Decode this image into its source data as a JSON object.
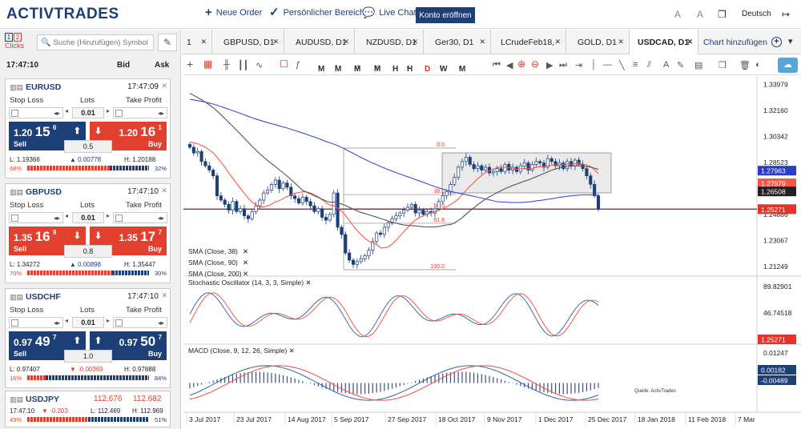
{
  "header": {
    "logo_main": "ACTIV",
    "logo_accent": "TRADES",
    "new_order": "Neue Order",
    "personal_area": "Persönlicher Bereich",
    "live_chat": "Live Chat",
    "open_account": "Konto eröffnen",
    "language": "Deutsch"
  },
  "left_panel": {
    "clicks_label": "Clicks",
    "click_options": [
      "1",
      "2"
    ],
    "search_placeholder": "Suche (Hinzufügen) Symbol",
    "clock": "17:47:10",
    "bid_label": "Bid",
    "ask_label": "Ask",
    "field_labels": {
      "stop_loss": "Stop Loss",
      "lots": "Lots",
      "take_profit": "Take Profit",
      "sell": "Sell",
      "buy": "Buy"
    },
    "instruments": [
      {
        "symbol": "EURUSD",
        "time": "17:47:09",
        "lots": "0.01",
        "sell_prefix": "1.20",
        "sell_big": "15",
        "sell_sup": "6",
        "buy_prefix": "1.20",
        "buy_big": "16",
        "buy_sup": "1",
        "sell_color": "#1d3f78",
        "buy_color": "#e2402e",
        "sell_dir": "up",
        "buy_dir": "down",
        "spread": "0.5",
        "low": "L: 1.19366",
        "change": "▲ 0.00778",
        "high": "H: 1.20188",
        "sell_pct": "68%",
        "buy_pct": "32%",
        "sell_share": 0.68
      },
      {
        "symbol": "GBPUSD",
        "time": "17:47:10",
        "lots": "0.01",
        "sell_prefix": "1.35",
        "sell_big": "16",
        "sell_sup": "9",
        "buy_prefix": "1.35",
        "buy_big": "17",
        "buy_sup": "7",
        "sell_color": "#e2402e",
        "buy_color": "#e2402e",
        "sell_dir": "down",
        "buy_dir": "down",
        "spread": "0.8",
        "low": "L: 1.34272",
        "change": "▲ 0.00898",
        "high": "H: 1.35447",
        "sell_pct": "70%",
        "buy_pct": "30%",
        "sell_share": 0.7
      },
      {
        "symbol": "USDCHF",
        "time": "17:47:10",
        "lots": "0.01",
        "sell_prefix": "0.97",
        "sell_big": "49",
        "sell_sup": "7",
        "buy_prefix": "0.97",
        "buy_big": "50",
        "buy_sup": "7",
        "sell_color": "#1d3f78",
        "buy_color": "#1d3f78",
        "sell_dir": "up",
        "buy_dir": "up",
        "spread": "1.0",
        "low": "L: 0.97407",
        "change": "▼ -0.00369",
        "high": "H: 0.97888",
        "sell_pct": "16%",
        "buy_pct": "84%",
        "sell_share": 0.16
      }
    ],
    "usdjpy": {
      "symbol": "USDJPY",
      "bid": "112.676",
      "ask": "112.682",
      "time": "17:47:10",
      "change": "▼ -0.203",
      "low": "L: 112.469",
      "high": "H: 112.969",
      "sell_pct": "49%",
      "buy_pct": "51%",
      "sell_share": 0.49
    }
  },
  "tabs": [
    {
      "label": "1",
      "active": false
    },
    {
      "label": "GBPUSD, D1",
      "active": false
    },
    {
      "label": "AUDUSD, D1",
      "active": false
    },
    {
      "label": "NZDUSD, D1",
      "active": false
    },
    {
      "label": "Ger30, D1",
      "active": false
    },
    {
      "label": "LCrudeFeb18,",
      "active": false
    },
    {
      "label": "GOLD, D1",
      "active": false
    },
    {
      "label": "USDCAD, D1",
      "active": true
    },
    {
      "label": "Chart hinzufügen",
      "active": false
    }
  ],
  "timeframes": [
    {
      "base": "M",
      "sub": "1",
      "sel": false
    },
    {
      "base": "M",
      "sub": "5",
      "sel": false
    },
    {
      "base": "M",
      "sub": "15",
      "sel": false
    },
    {
      "base": "M",
      "sub": "30",
      "sel": false
    },
    {
      "base": "H",
      "sub": "1",
      "sel": false
    },
    {
      "base": "H",
      "sub": "4",
      "sel": false
    },
    {
      "base": "D",
      "sub": "1",
      "sel": true
    },
    {
      "base": "W",
      "sub": "1",
      "sel": false
    },
    {
      "base": "M",
      "sub": "n",
      "sel": false
    }
  ],
  "chart_data": {
    "type": "candlestick",
    "symbol": "USDCAD",
    "timeframe": "D1",
    "price_axis": [
      "1.33979",
      "1.32160",
      "1.30342",
      "1.28523",
      "1.26704",
      "1.24886",
      "1.23067",
      "1.21249"
    ],
    "price_ylim": [
      1.2075,
      1.3458
    ],
    "price_tags": [
      {
        "label": "1.27963",
        "value": 1.27963,
        "color": "#2a3ec8"
      },
      {
        "label": "1.27079",
        "value": 1.27079,
        "color": "#f05a4a"
      },
      {
        "label": "1.26508",
        "value": 1.26508,
        "color": "#222222"
      },
      {
        "label": "1.25271",
        "value": 1.25271,
        "color": "#e4332a"
      }
    ],
    "x_axis": [
      "3 Jul 2017",
      "23 Jul 2017",
      "14 Aug 2017",
      "5 Sep 2017",
      "27 Sep 2017",
      "18 Oct 2017",
      "9 Nov 2017",
      "1 Dec 2017",
      "25 Dec 2017",
      "18 Jan 2018",
      "11 Feb 2018",
      "7 Mar"
    ],
    "candles_close": [
      1.296,
      1.292,
      1.293,
      1.286,
      1.283,
      1.28,
      1.276,
      1.262,
      1.259,
      1.256,
      1.252,
      1.258,
      1.251,
      1.253,
      1.248,
      1.246,
      1.251,
      1.255,
      1.259,
      1.264,
      1.266,
      1.27,
      1.273,
      1.267,
      1.271,
      1.268,
      1.262,
      1.26,
      1.257,
      1.261,
      1.258,
      1.255,
      1.251,
      1.253,
      1.247,
      1.245,
      1.249,
      1.264,
      1.24,
      1.235,
      1.222,
      1.217,
      1.214,
      1.216,
      1.218,
      1.22,
      1.224,
      1.23,
      1.236,
      1.235,
      1.24,
      1.243,
      1.246,
      1.248,
      1.25,
      1.252,
      1.254,
      1.256,
      1.25,
      1.252,
      1.249,
      1.251,
      1.25,
      1.253,
      1.258,
      1.262,
      1.265,
      1.27,
      1.275,
      1.282,
      1.286,
      1.289,
      1.284,
      1.281,
      1.283,
      1.28,
      1.282,
      1.278,
      1.279,
      1.281,
      1.279,
      1.284,
      1.28,
      1.282,
      1.279,
      1.283,
      1.285,
      1.28,
      1.284,
      1.286,
      1.285,
      1.282,
      1.288,
      1.286,
      1.283,
      1.285,
      1.281,
      1.286,
      1.283,
      1.287,
      1.284,
      1.281,
      1.276,
      1.27,
      1.262,
      1.253
    ],
    "sma_series": [
      {
        "name": "SMA (Close, 38)",
        "color": "#f05a4a"
      },
      {
        "name": "SMA (Close, 90)",
        "color": "#555555"
      },
      {
        "name": "SMA (Close, 200)",
        "color": "#3a4fd0"
      }
    ],
    "fib_levels": [
      "0.0",
      "38.2",
      "50.0",
      "61.8",
      "100.0"
    ],
    "stochastic": {
      "title": "Stochastic Oscillator (14, 3, 3, Simple)",
      "axis": [
        "89.82901",
        "46.74518"
      ]
    },
    "macd": {
      "title": "MACD (Close, 9, 12, 26, Simple)",
      "axis": [
        "0.01247",
        "0.00182",
        "-0.00489"
      ]
    },
    "watermark": "Quelle: ActivTrades"
  }
}
